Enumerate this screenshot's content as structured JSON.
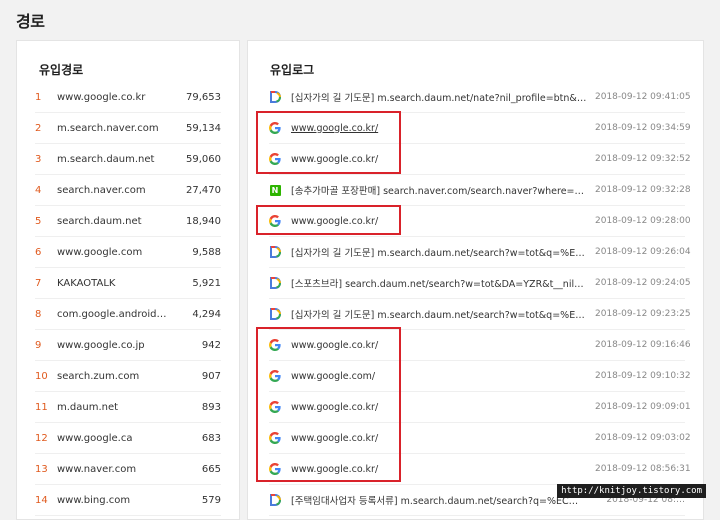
{
  "page_title": "경로",
  "left_card": {
    "heading": "유입경로",
    "rows": [
      {
        "rank": "1",
        "domain": "www.google.co.kr",
        "count": "79,653"
      },
      {
        "rank": "2",
        "domain": "m.search.naver.com",
        "count": "59,134"
      },
      {
        "rank": "3",
        "domain": "m.search.daum.net",
        "count": "59,060"
      },
      {
        "rank": "4",
        "domain": "search.naver.com",
        "count": "27,470"
      },
      {
        "rank": "5",
        "domain": "search.daum.net",
        "count": "18,940"
      },
      {
        "rank": "6",
        "domain": "www.google.com",
        "count": "9,588"
      },
      {
        "rank": "7",
        "domain": "KAKAOTALK",
        "count": "5,921"
      },
      {
        "rank": "8",
        "domain": "com.google.android.…",
        "count": "4,294"
      },
      {
        "rank": "9",
        "domain": "www.google.co.jp",
        "count": "942"
      },
      {
        "rank": "10",
        "domain": "search.zum.com",
        "count": "907"
      },
      {
        "rank": "11",
        "domain": "m.daum.net",
        "count": "893"
      },
      {
        "rank": "12",
        "domain": "www.google.ca",
        "count": "683"
      },
      {
        "rank": "13",
        "domain": "www.naver.com",
        "count": "665"
      },
      {
        "rank": "14",
        "domain": "www.bing.com",
        "count": "579"
      }
    ]
  },
  "right_card": {
    "heading": "유입로그",
    "rows": [
      {
        "icon": "daum",
        "text": "[십자가의 길 기도문] m.search.daum.net/nate?nil_profile=btn&w=tot…",
        "time": "2018-09-12 09:41:05",
        "underline": false
      },
      {
        "icon": "google",
        "text": "www.google.co.kr/",
        "time": "2018-09-12 09:34:59",
        "underline": true
      },
      {
        "icon": "google",
        "text": "www.google.co.kr/",
        "time": "2018-09-12 09:32:52",
        "underline": false
      },
      {
        "icon": "naver",
        "text": "[송추가마골 포장판매] search.naver.com/search.naver?where=nexea…",
        "time": "2018-09-12 09:32:28",
        "underline": false
      },
      {
        "icon": "google",
        "text": "www.google.co.kr/",
        "time": "2018-09-12 09:28:00",
        "underline": false
      },
      {
        "icon": "daum",
        "text": "[십자가의 길 기도문] m.search.daum.net/search?w=tot&q=%EC%8B…",
        "time": "2018-09-12 09:26:04",
        "underline": false
      },
      {
        "icon": "daum",
        "text": "[스포츠브라] search.daum.net/search?w=tot&DA=YZR&t__nil_searc…",
        "time": "2018-09-12 09:24:05",
        "underline": false
      },
      {
        "icon": "daum",
        "text": "[십자가의 길 기도문] m.search.daum.net/search?w=tot&q=%EC%8B…",
        "time": "2018-09-12 09:23:25",
        "underline": false
      },
      {
        "icon": "google",
        "text": "www.google.co.kr/",
        "time": "2018-09-12 09:16:46",
        "underline": false
      },
      {
        "icon": "google",
        "text": "www.google.com/",
        "time": "2018-09-12 09:10:32",
        "underline": false
      },
      {
        "icon": "google",
        "text": "www.google.co.kr/",
        "time": "2018-09-12 09:09:01",
        "underline": false
      },
      {
        "icon": "google",
        "text": "www.google.co.kr/",
        "time": "2018-09-12 09:03:02",
        "underline": false
      },
      {
        "icon": "google",
        "text": "www.google.co.kr/",
        "time": "2018-09-12 08:56:31",
        "underline": false
      },
      {
        "icon": "daum",
        "text": "[주택임대사업자 등록서류] m.search.daum.net/search?q=%EC%A3%…",
        "time": "2018-09-12 08:…",
        "underline": false
      }
    ]
  },
  "watermark": "http://knitjoy.tistory.com",
  "colors": {
    "rank": "#e05a1e",
    "highlight": "#d9222a",
    "naver": "#2db400"
  }
}
